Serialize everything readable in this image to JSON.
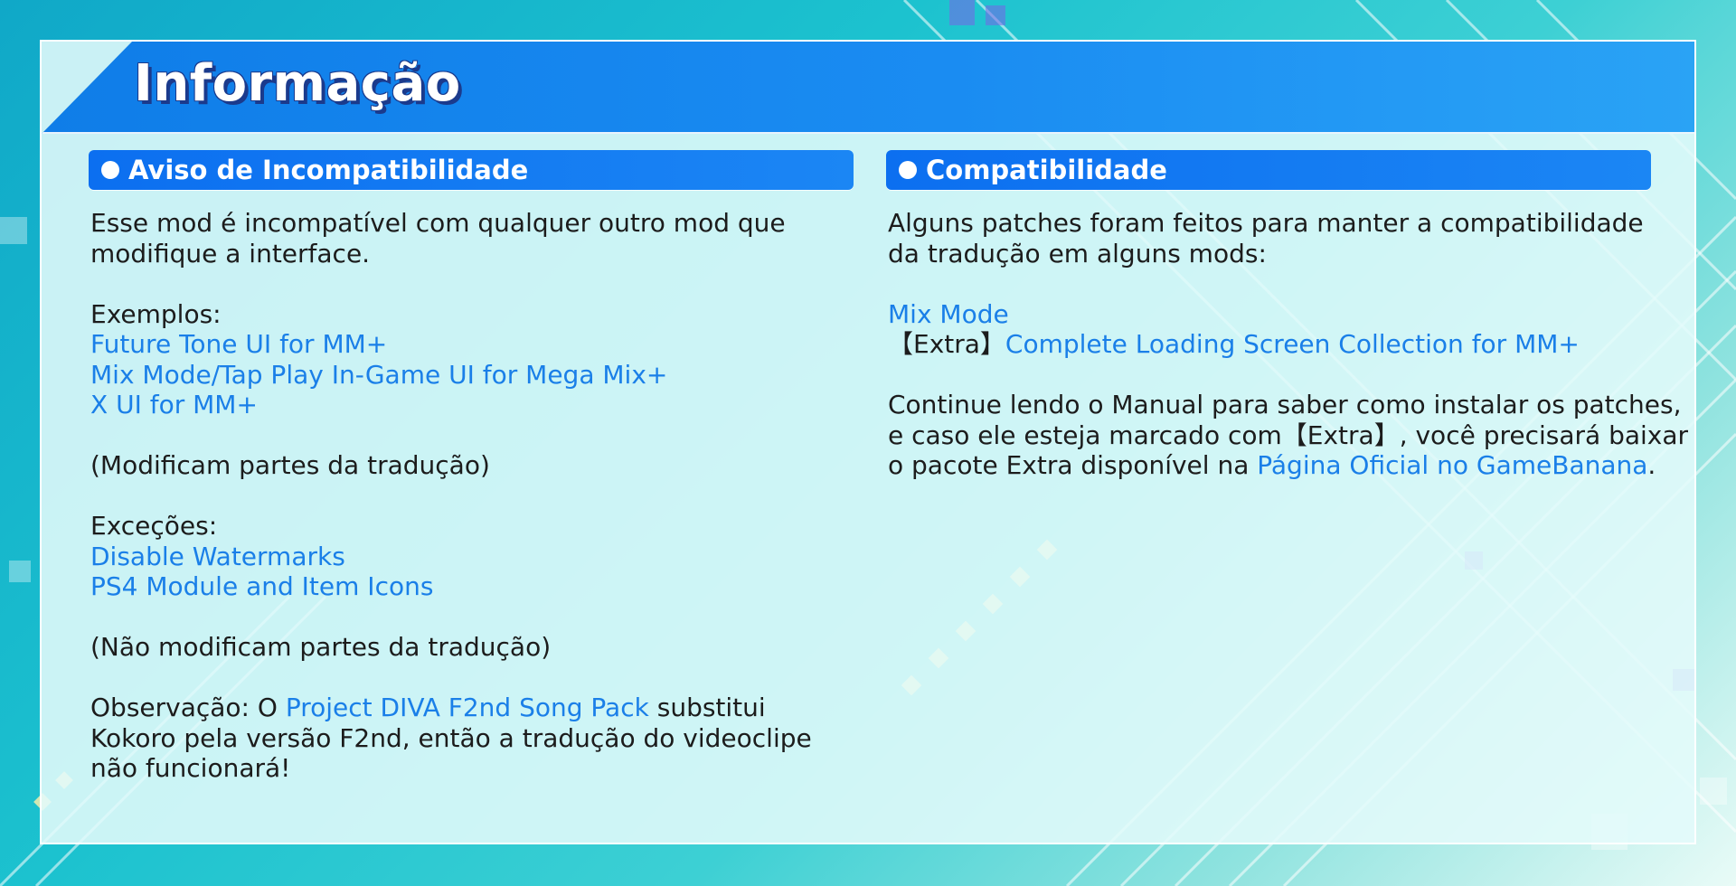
{
  "panel": {
    "title": "Informação"
  },
  "incompatibility": {
    "heading": "Aviso de Incompatibilidade",
    "intro": [
      "Esse mod é incompatível com qualquer outro mod que",
      "modifique a interface."
    ],
    "examples_label": "Exemplos:",
    "examples": [
      "Future Tone UI for MM+",
      "Mix Mode/Tap Play In-Game UI for Mega Mix+",
      "X UI for MM+"
    ],
    "examples_note": "(Modificam partes da tradução)",
    "exceptions_label": "Exceções:",
    "exceptions": [
      "Disable Watermarks",
      "PS4 Module and Item Icons"
    ],
    "exceptions_note": "(Não modificam partes da tradução)",
    "observation": {
      "prefix": "Observação: O ",
      "link": "Project DIVA F2nd Song Pack",
      "suffix": " substitui",
      "line2": "Kokoro pela versão F2nd, então a tradução do videoclipe",
      "line3": "não funcionará!"
    }
  },
  "compatibility": {
    "heading": "Compatibilidade",
    "intro": [
      "Alguns patches foram feitos para manter a compatibilidade",
      "da tradução em alguns mods:"
    ],
    "mods": [
      {
        "prefix": "",
        "link": "Mix Mode"
      },
      {
        "prefix": "【Extra】",
        "link": "Complete Loading Screen Collection for MM+"
      }
    ],
    "manual": {
      "line1": "Continue lendo o Manual para saber como instalar os patches,",
      "line2": "e caso ele esteja marcado com【Extra】, você precisará baixar",
      "line3_prefix": "o pacote Extra disponível na ",
      "line3_link": "Página Oficial no GameBanana",
      "line3_suffix": "."
    }
  },
  "colors": {
    "header_blue": "#1a8cf2",
    "section_blue": "#0c6ff0",
    "link_blue": "#1a7fe8",
    "panel_bg": "#e4fafa",
    "body_text": "#1c1c1c"
  },
  "icons": {
    "section_bullet": "white-dot-icon"
  }
}
